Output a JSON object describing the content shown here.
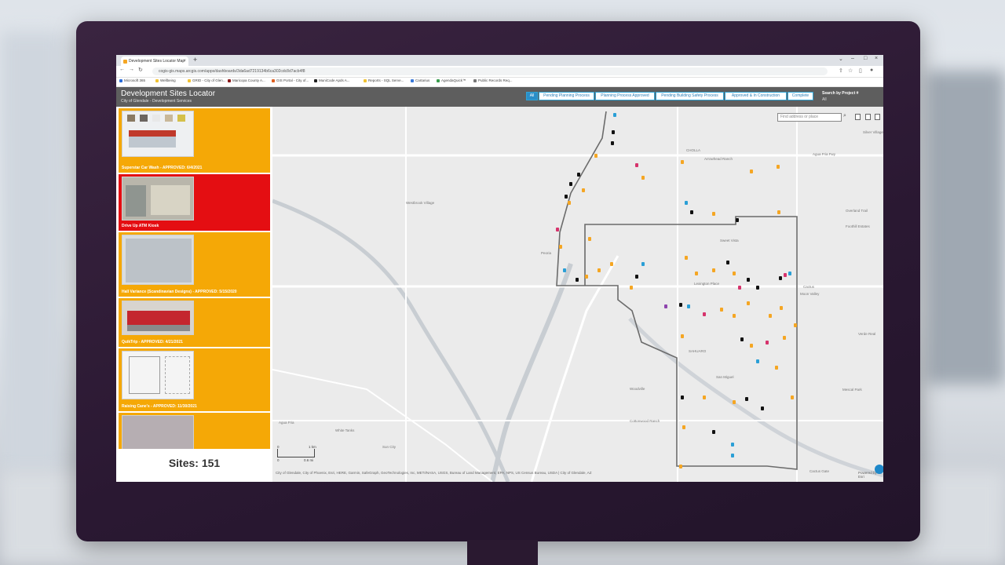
{
  "browser": {
    "tab_title": "Development Sites Locator Map",
    "url": "cogis-gis.maps.arcgis.com/apps/dashboards/3da6ad7219134b6ca302cdc8d7acb4f8",
    "bookmarks": [
      {
        "label": "Microsoft 365",
        "color": "#2b6cd8"
      },
      {
        "label": "Wellbeing",
        "color": "#f1c232"
      },
      {
        "label": "GRID - City of Glen...",
        "color": "#f1c232"
      },
      {
        "label": "Maricopa County A...",
        "color": "#8b1a1a"
      },
      {
        "label": "GIS Portal - City of...",
        "color": "#e06020"
      },
      {
        "label": "MuniCode Apds A...",
        "color": "#222222"
      },
      {
        "label": "Reports - SQL Serve...",
        "color": "#f1c232"
      },
      {
        "label": "Cartarius",
        "color": "#3a79d8"
      },
      {
        "label": "AgendaQuick™",
        "color": "#3a9d4e"
      },
      {
        "label": "Public Records Req...",
        "color": "#777777"
      }
    ]
  },
  "app": {
    "title": "Development Sites Locator",
    "subtitle": "City of Glendale - Development Services",
    "filters": [
      {
        "label": "All",
        "active": true
      },
      {
        "label": "Pending Planning Process",
        "active": false
      },
      {
        "label": "Planning Process Approved",
        "active": false
      },
      {
        "label": "Pending Building Safety Process",
        "active": false
      },
      {
        "label": "Approved & In Construction",
        "active": false
      },
      {
        "label": "Complete",
        "active": false
      }
    ],
    "search_label": "Search by Project #",
    "search_value": "All"
  },
  "sites": [
    {
      "label": "Superstar Car Wash - APPROVED: 6/4/2021",
      "selected": false
    },
    {
      "label": "Drive Up ATM Kiosk",
      "selected": true
    },
    {
      "label": "Hall Variance (Scandinavian Designs) - APPROVED: 5/15/2020",
      "selected": false
    },
    {
      "label": "QuikTrip - APPROVED: 4/21/2021",
      "selected": false
    },
    {
      "label": "Raising Cane's - APPROVED: 11/30/2021",
      "selected": false
    },
    {
      "label": "",
      "selected": false
    }
  ],
  "sites_count": "Sites: 151",
  "map": {
    "search_placeholder": "Find address or place",
    "scale_top": "1 km",
    "scale_bottom": "0.6 mi",
    "scale_zero_top": "0",
    "scale_zero_bottom": "0",
    "attribution": "City of Glendale, City of Phoenix, Esri, HERE, Garmin, SafeGraph, GeoTechnologies, Inc, METI/NASA, USGS, Bureau of Land Management, EPA, NPS, US Census Bureau, USDA | City of Glendale, AZ",
    "powered": "Powered by Esri",
    "place_labels": [
      "CHOLLA",
      "Arrowhead Ranch",
      "Westbrook Village",
      "Peoria",
      "Sweet Vista",
      "Lexington Place",
      "SAHUARO",
      "San Miguel",
      "Woodville",
      "Cottonwood Ranch",
      "Sun City",
      "White Tanks",
      "Agua Fria",
      "Overland Trail",
      "Foothill Estates",
      "Cactus",
      "Moon Valley",
      "Verde Real",
      "Mescal Park",
      "Cactus Gate",
      "Silver Village",
      "Agua Fria Fwy"
    ],
    "status_colors": {
      "pending": "#f5a623",
      "approved": "#111111",
      "review": "#2a9fd6",
      "other": "#d6336c",
      "purple": "#8e44ad"
    }
  }
}
